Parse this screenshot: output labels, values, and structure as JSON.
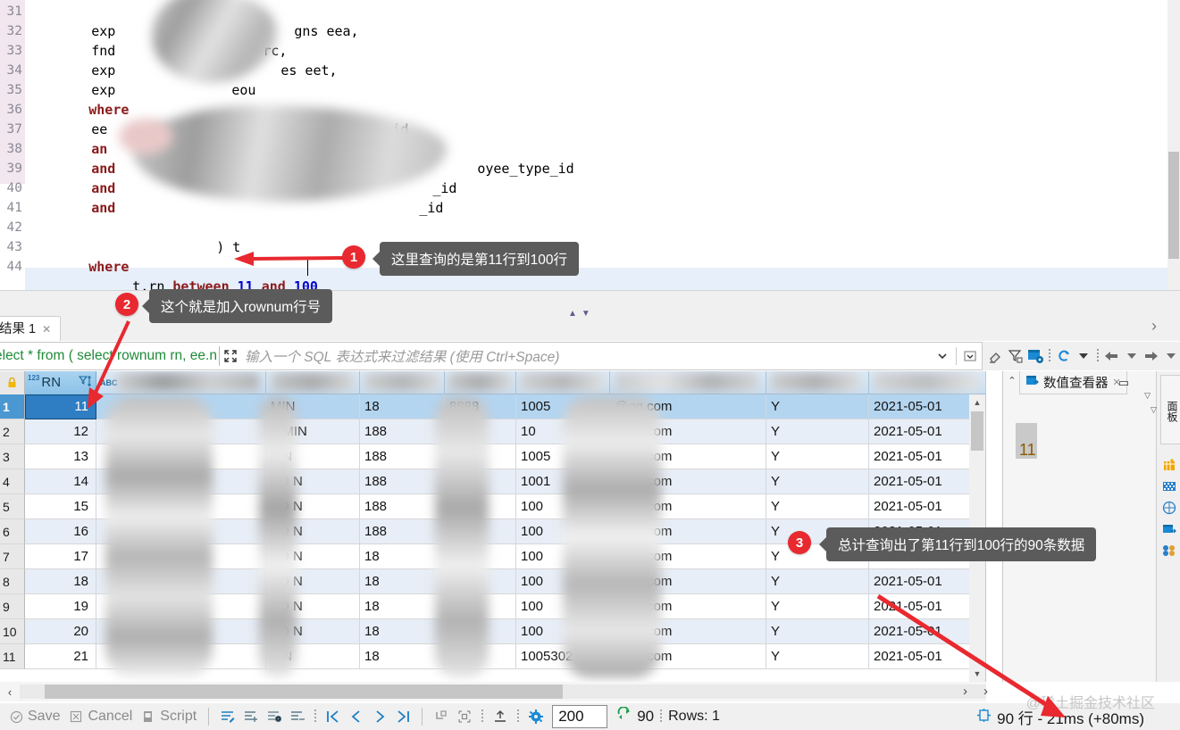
{
  "editor": {
    "lines": [
      {
        "n": "31",
        "indent": 8,
        "text": "exp",
        "tail": "gns eea,"
      },
      {
        "n": "32",
        "indent": 8,
        "text": "fnd",
        "tail": "rc,"
      },
      {
        "n": "33",
        "indent": 8,
        "text": "exp",
        "tail": "es eet,"
      },
      {
        "n": "34",
        "indent": 8,
        "text": "exp",
        "tail": "eou"
      },
      {
        "n": "35",
        "indent": 4,
        "text": "where",
        "tail": ""
      },
      {
        "n": "36",
        "indent": 8,
        "text": "ee",
        "tail": "_id"
      },
      {
        "n": "37",
        "indent": 8,
        "text": "an",
        "tail": "y_id"
      },
      {
        "n": "38",
        "indent": 8,
        "text": "and",
        "tail": "oyee_type_id"
      },
      {
        "n": "39",
        "indent": 8,
        "text": "and",
        "tail": "_id"
      },
      {
        "n": "40",
        "indent": 8,
        "text": "and",
        "tail": "_id"
      },
      {
        "n": "41",
        "indent": 0,
        "text": "",
        "tail": ""
      },
      {
        "n": "42",
        "indent": 12,
        "text": ") t",
        "tail": ""
      },
      {
        "n": "43",
        "indent": 0,
        "text": "where",
        "tail": ""
      },
      {
        "n": "44",
        "indent": 4,
        "text": "t.rn between 11 and 100",
        "tail": ""
      }
    ],
    "line44": {
      "prefix": "t.rn ",
      "keyword": "between ",
      "num1": "11",
      "and": " and ",
      "num2": "100"
    },
    "line35_kw": "where",
    "line43_kw": "where"
  },
  "tabs": {
    "result_tab_label": "结果 1",
    "close_glyph": "✕",
    "nav_prev": "‹",
    "nav_next": "›"
  },
  "filter": {
    "sql_text": "elect * from ( select rownum rn, ee.n",
    "placeholder": "输入一个 SQL 表达式来过滤结果 (使用 Ctrl+Space)"
  },
  "grid": {
    "columns": [
      {
        "key": "rn",
        "label": "RN",
        "type_tag": "123"
      },
      {
        "key": "c1",
        "label": "",
        "type_tag": "ABC"
      },
      {
        "key": "c2",
        "label": "",
        "type_tag": ""
      },
      {
        "key": "c3",
        "label": "",
        "type_tag": ""
      },
      {
        "key": "c4",
        "label": "",
        "type_tag": ""
      },
      {
        "key": "c5",
        "label": "",
        "type_tag": ""
      },
      {
        "key": "c6",
        "label": "",
        "type_tag": ""
      },
      {
        "key": "c7",
        "label": "",
        "type_tag": ""
      },
      {
        "key": "c8",
        "label": "",
        "type_tag": ""
      }
    ],
    "rows": [
      {
        "no": "1",
        "rn": "11",
        "mid": "",
        "admin": "MIN",
        "n1": "18",
        "n2": "8888",
        "n3": "1005",
        "email": "@qq.com",
        "flag": "Y",
        "date": "2021-05-01"
      },
      {
        "no": "2",
        "rn": "12",
        "mid": "",
        "admin": "A  MIN",
        "n1": "188",
        "n2": "888",
        "n3": "10",
        "email": "@qq.com",
        "flag": "Y",
        "date": "2021-05-01"
      },
      {
        "no": "3",
        "rn": "13",
        "mid": "",
        "admin": "A   N",
        "n1": "188",
        "n2": "888",
        "n3": "1005",
        "email": "@qq.com",
        "flag": "Y",
        "date": "2021-05-01"
      },
      {
        "no": "4",
        "rn": "14",
        "mid": "",
        "admin": "AD  N",
        "n1": "188",
        "n2": "888",
        "n3": "1001",
        "email": "@qq.com",
        "flag": "Y",
        "date": "2021-05-01"
      },
      {
        "no": "5",
        "rn": "15",
        "mid": "",
        "admin": "AD   N",
        "n1": "188",
        "n2": "888",
        "n3": "100",
        "email": "@qq.com",
        "flag": "Y",
        "date": "2021-05-01"
      },
      {
        "no": "6",
        "rn": "16",
        "mid": "",
        "admin": "AD   N",
        "n1": "188",
        "n2": "88",
        "n3": "100",
        "email": "@qq.com",
        "flag": "Y",
        "date": "2021-05-01"
      },
      {
        "no": "7",
        "rn": "17",
        "mid": "",
        "admin": "AD   N",
        "n1": "18",
        "n2": "888",
        "n3": "100",
        "email": "@qq.com",
        "flag": "Y",
        "date": "2021-05-01"
      },
      {
        "no": "8",
        "rn": "18",
        "mid": "",
        "admin": "AD   N",
        "n1": "18",
        "n2": "888",
        "n3": "100",
        "email": "@qq.com",
        "flag": "Y",
        "date": "2021-05-01"
      },
      {
        "no": "9",
        "rn": "19",
        "mid": "",
        "admin": "AD   N",
        "n1": "18",
        "n2": "888",
        "n3": "100",
        "email": "@qq.com",
        "flag": "Y",
        "date": "2021-05-01"
      },
      {
        "no": "10",
        "rn": "20",
        "mid": "",
        "admin": "AD   N",
        "n1": "18",
        "n2": "888",
        "n3": "100",
        "email": "@qq.com",
        "flag": "Y",
        "date": "2021-05-01"
      },
      {
        "no": "11",
        "rn": "21",
        "mid": "",
        "admin": "A    N",
        "n1": "18",
        "n2": "888",
        "n3": "1005302",
        "email": "@qq.com",
        "flag": "Y",
        "date": "2021-05-01"
      }
    ]
  },
  "value_viewer": {
    "title": "数值查看器",
    "close_glyph": "✕",
    "value": "11",
    "minimize_glyph": "▭",
    "menu_glyph": "▽",
    "collapse_glyph": "⌃"
  },
  "right_rail": {
    "tab_label": "面板"
  },
  "bottom": {
    "save": "Save",
    "cancel": "Cancel",
    "script": "Script",
    "fetch_size": "200",
    "fetched_rows": "90",
    "rows_label": "Rows: 1"
  },
  "status": {
    "result_text": "90 行 - 21ms (+80ms)",
    "watermark": "@稀土掘金技术社区"
  },
  "annotations": [
    {
      "num": "1",
      "text": "这里查询的是第11行到100行"
    },
    {
      "num": "2",
      "text": "这个就是加入rownum行号"
    },
    {
      "num": "3",
      "text": "总计查询出了第11行到100行的90条数据"
    }
  ],
  "colors": {
    "accent_red": "#e8292f",
    "callout_bg": "#5b5b5b",
    "sql_green": "#1f8b38",
    "keyword_red": "#8b1a1a",
    "number_blue": "#0000cc",
    "selection_blue": "#b4d5f0"
  }
}
